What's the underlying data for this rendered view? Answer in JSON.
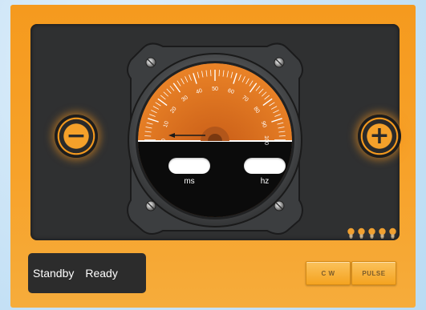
{
  "gauge": {
    "scale_min": 0,
    "scale_max": 100,
    "ticks": [
      "0",
      "10",
      "20",
      "30",
      "40",
      "50",
      "60",
      "70",
      "80",
      "90",
      "100"
    ],
    "needle_value": 0,
    "face_color": "#e8761f",
    "needle_color": "#1a1a1a"
  },
  "readouts": {
    "ms_value": "",
    "ms_label": "ms",
    "hz_value": "",
    "hz_label": "hz"
  },
  "controls": {
    "decrease_icon": "minus-icon",
    "increase_icon": "plus-icon"
  },
  "indicator_bulbs": {
    "count": 5,
    "color": "#f0a030"
  },
  "status": {
    "state": "Standby",
    "detail": "Ready"
  },
  "modes": {
    "cw_label": "C W",
    "pulse_label": "PULSE"
  },
  "colors": {
    "panel": "#f59a1e",
    "display": "#2f3031",
    "accent": "#f5a12a"
  }
}
